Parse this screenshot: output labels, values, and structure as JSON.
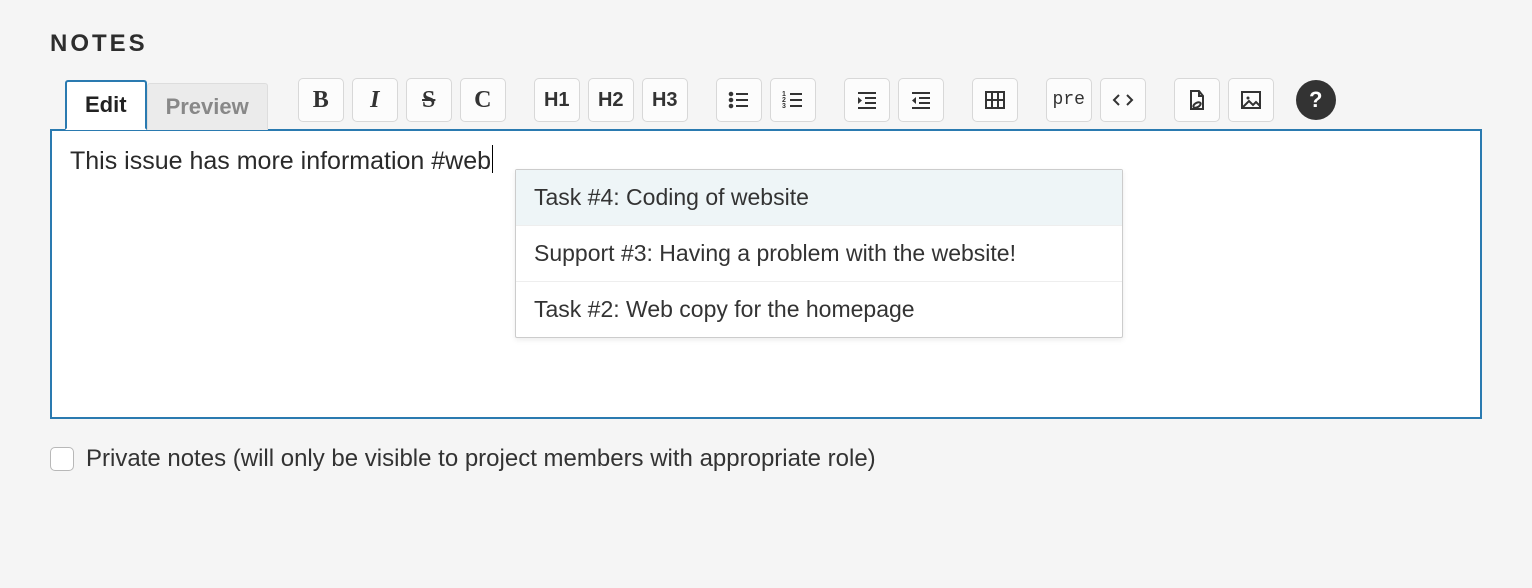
{
  "section_title": "NOTES",
  "tabs": {
    "edit": "Edit",
    "preview": "Preview"
  },
  "toolbar": {
    "bold": "B",
    "italic": "I",
    "strike": "S",
    "code_inline": "C",
    "h1": "H1",
    "h2": "H2",
    "h3": "H3",
    "pre": "pre",
    "code_block": "</>"
  },
  "editor": {
    "text": "This issue has more information #web"
  },
  "autocomplete": {
    "items": [
      "Task #4: Coding of website",
      "Support #3: Having a problem with the website!",
      "Task #2: Web copy for the homepage"
    ],
    "selected_index": 0
  },
  "private_notes": {
    "checked": false,
    "label": "Private notes (will only be visible to project members with appropriate role)"
  }
}
